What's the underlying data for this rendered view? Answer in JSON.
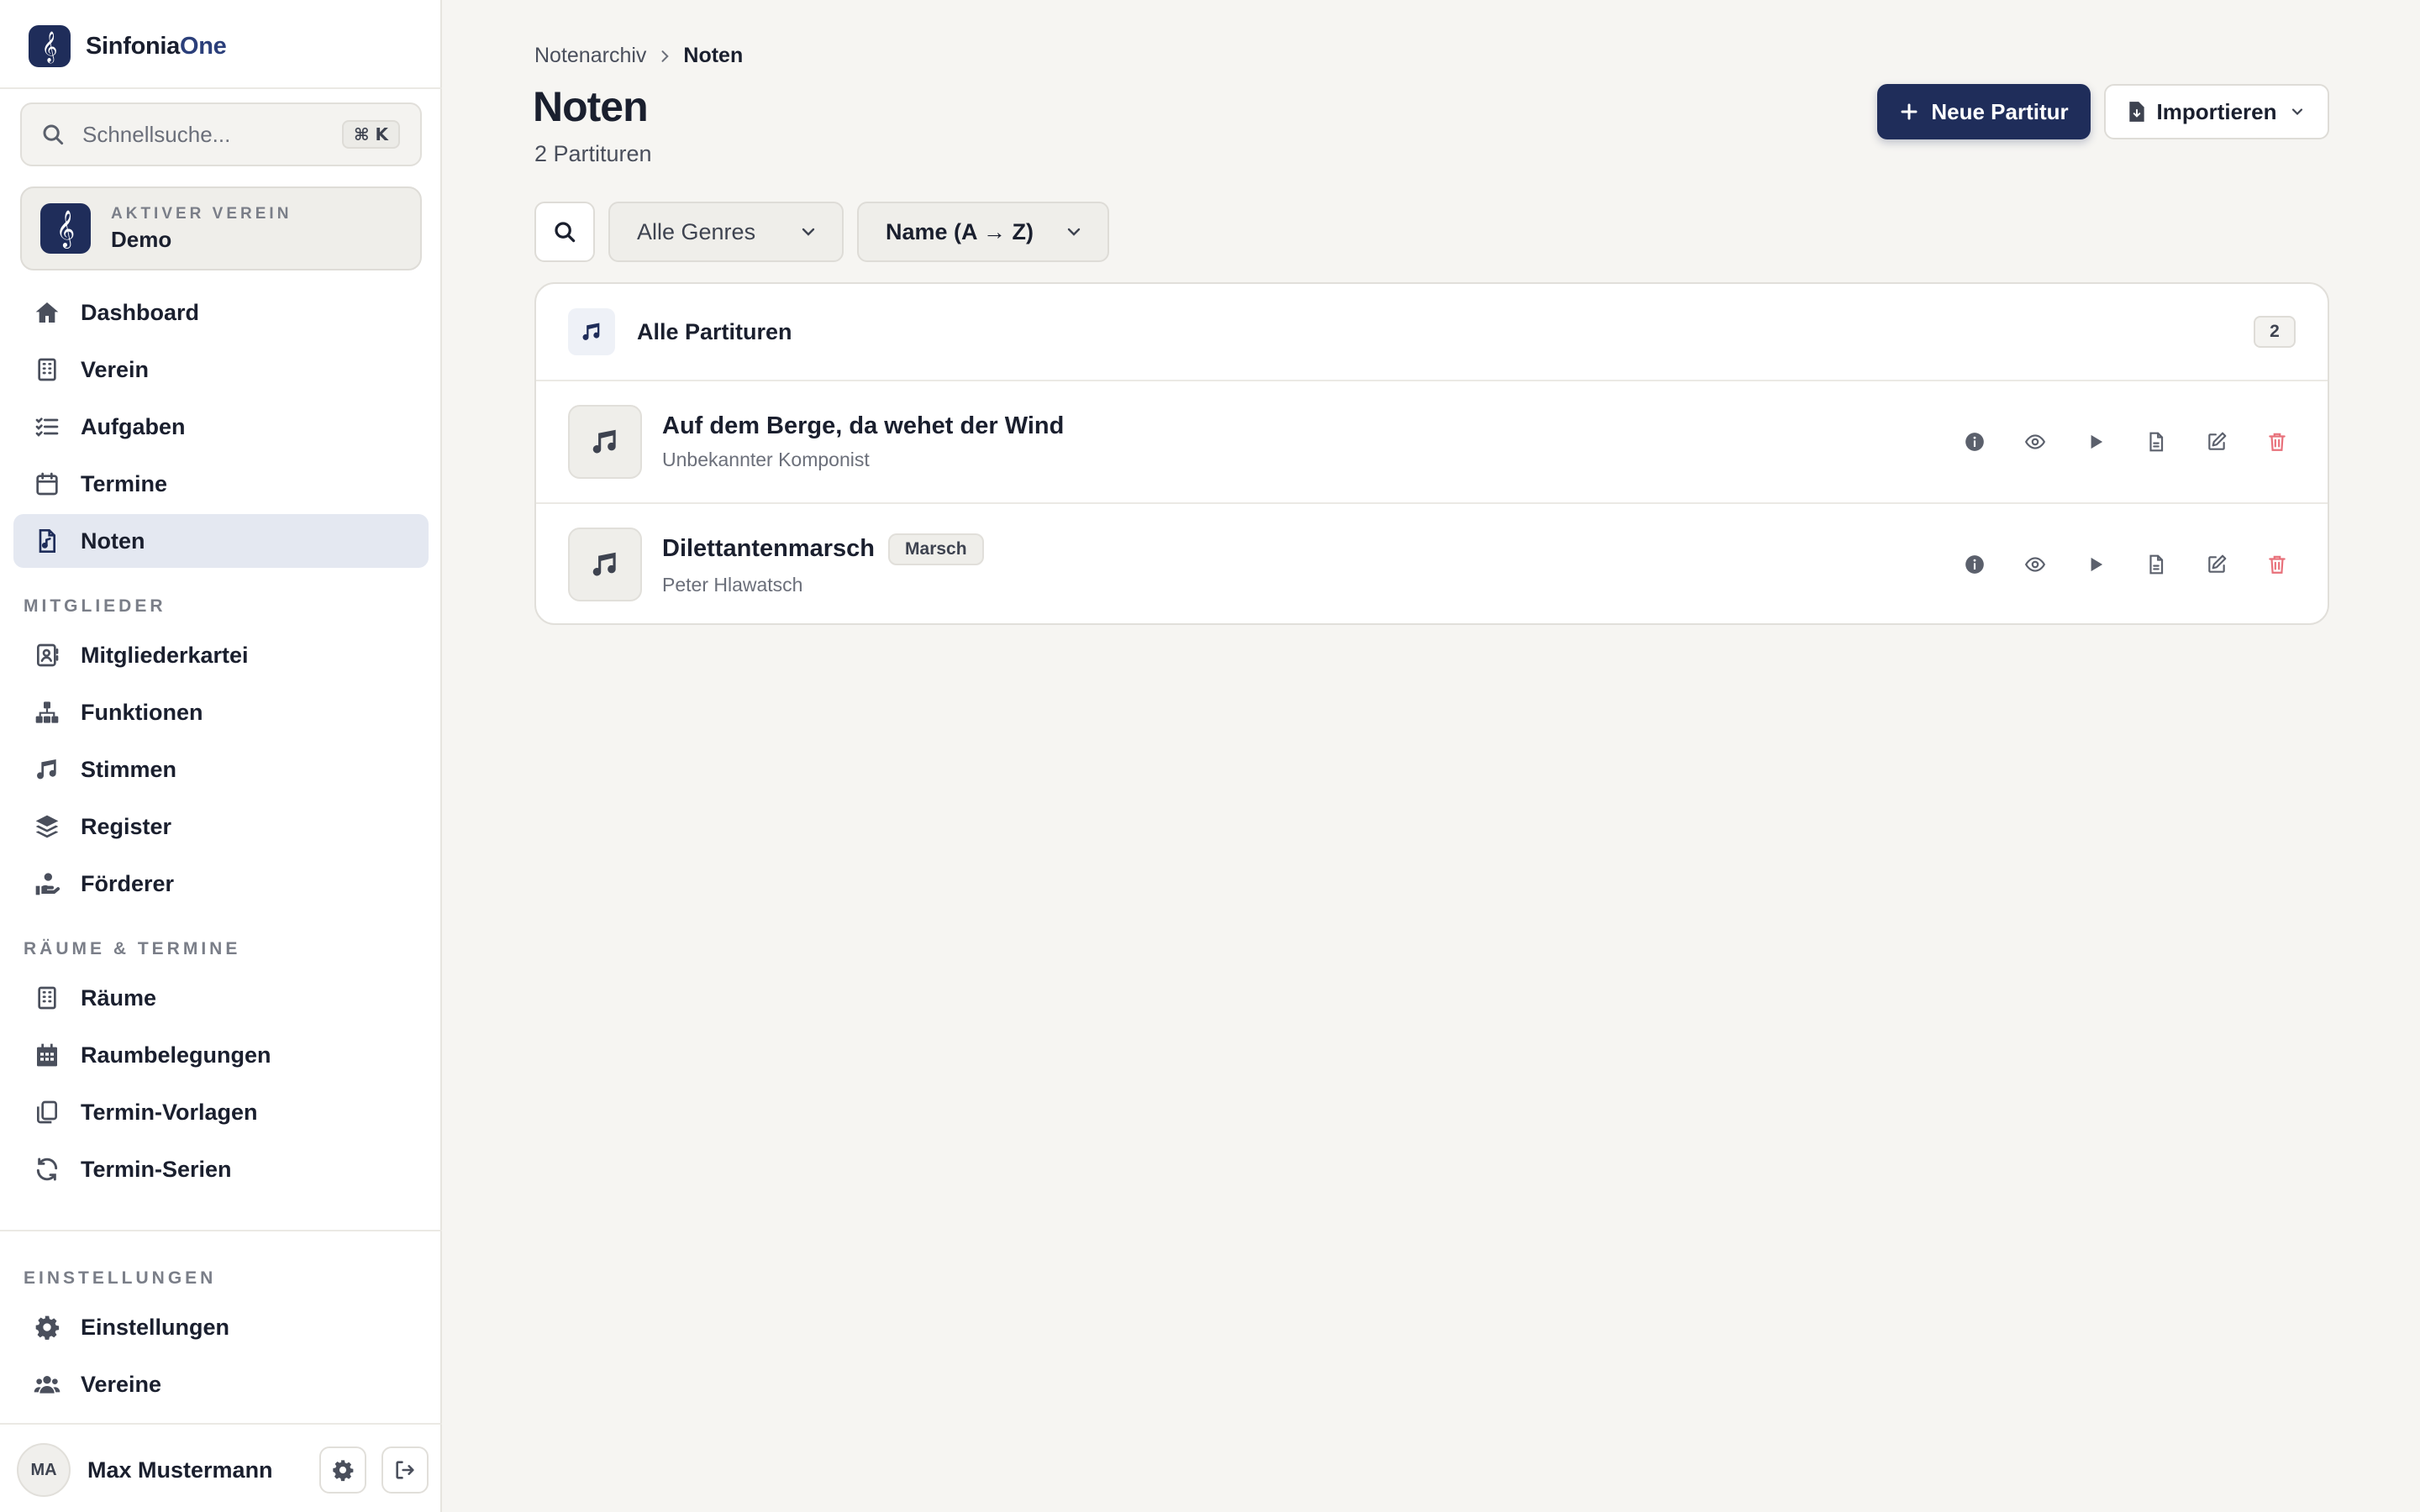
{
  "app": {
    "name_primary": "Sinfonia",
    "name_accent": "One"
  },
  "search": {
    "placeholder": "Schnellsuche...",
    "shortcut": "⌘ K"
  },
  "club": {
    "label": "AKTIVER VEREIN",
    "name": "Demo"
  },
  "nav": {
    "main": [
      {
        "label": "Dashboard",
        "icon": "home-icon"
      },
      {
        "label": "Verein",
        "icon": "building-icon"
      },
      {
        "label": "Aufgaben",
        "icon": "tasks-icon"
      },
      {
        "label": "Termine",
        "icon": "calendar-icon"
      },
      {
        "label": "Noten",
        "icon": "sheet-music-icon",
        "active": true
      }
    ],
    "members_label": "MITGLIEDER",
    "members": [
      {
        "label": "Mitgliederkartei",
        "icon": "contact-card-icon"
      },
      {
        "label": "Funktionen",
        "icon": "hierarchy-icon"
      },
      {
        "label": "Stimmen",
        "icon": "music-note-icon"
      },
      {
        "label": "Register",
        "icon": "layers-icon"
      },
      {
        "label": "Förderer",
        "icon": "supporter-icon"
      }
    ],
    "rooms_label": "RÄUME & TERMINE",
    "rooms": [
      {
        "label": "Räume",
        "icon": "building-icon"
      },
      {
        "label": "Raumbelegungen",
        "icon": "calendar-grid-icon"
      },
      {
        "label": "Termin-Vorlagen",
        "icon": "copy-icon"
      },
      {
        "label": "Termin-Serien",
        "icon": "refresh-icon"
      }
    ],
    "settings_label": "EINSTELLUNGEN",
    "settings": [
      {
        "label": "Einstellungen",
        "icon": "gear-icon"
      },
      {
        "label": "Vereine",
        "icon": "users-icon"
      }
    ]
  },
  "user": {
    "initials": "MA",
    "name": "Max Mustermann"
  },
  "breadcrumb": {
    "parent": "Notenarchiv",
    "current": "Noten"
  },
  "page": {
    "title": "Noten",
    "subtitle": "2 Partituren"
  },
  "actions": {
    "new_score": "Neue Partitur",
    "import": "Importieren"
  },
  "filters": {
    "genre": "Alle Genres",
    "sort": "Name (A → Z)"
  },
  "list": {
    "title": "Alle Partituren",
    "count": "2",
    "items": [
      {
        "title": "Auf dem Berge, da wehet der Wind",
        "composer": "Unbekannter Komponist",
        "genre": ""
      },
      {
        "title": "Dilettantenmarsch",
        "composer": "Peter Hlawatsch",
        "genre": "Marsch"
      }
    ]
  },
  "colors": {
    "brand": "#1f2d5a",
    "background": "#f6f5f2",
    "active_nav": "#e4e8f1",
    "danger": "#e8707a"
  }
}
